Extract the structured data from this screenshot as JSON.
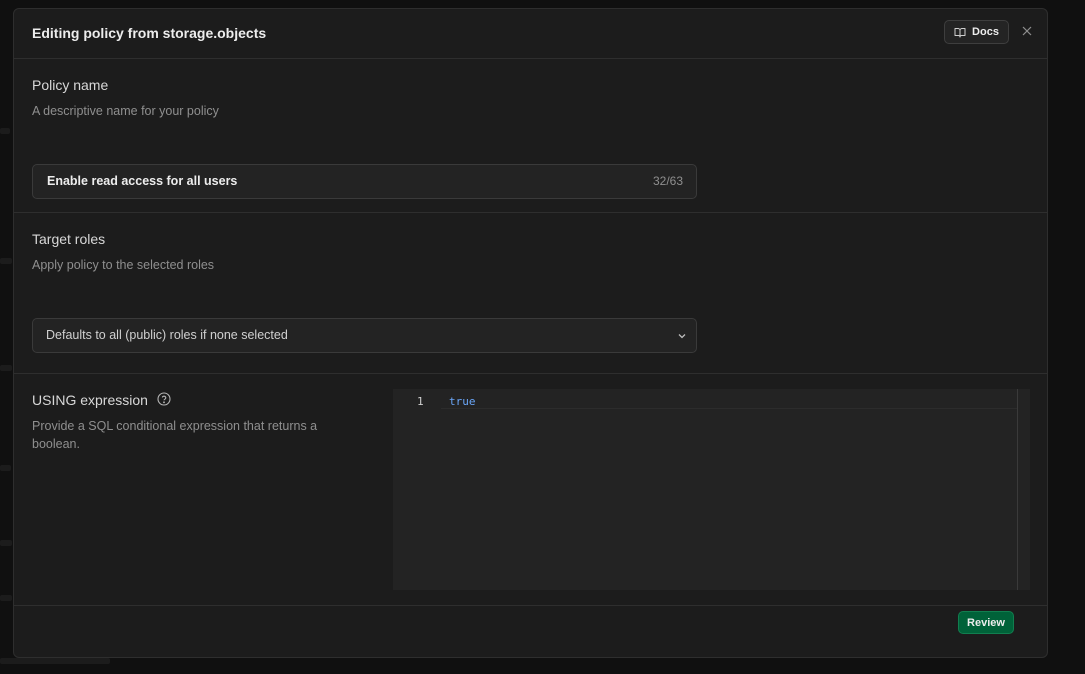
{
  "modal": {
    "title": "Editing policy from storage.objects",
    "docs_label": "Docs"
  },
  "policy_name": {
    "label": "Policy name",
    "description": "A descriptive name for your policy",
    "value": "Enable read access for all users",
    "counter": "32/63"
  },
  "target_roles": {
    "label": "Target roles",
    "description": "Apply policy to the selected roles",
    "selected_value": "Defaults to all (public) roles if none selected"
  },
  "using_expression": {
    "label": "USING expression",
    "description": "Provide a SQL conditional expression that returns a boolean.",
    "line_number": "1",
    "code": "true"
  },
  "footer": {
    "review_label": "Review"
  },
  "colors": {
    "accent": "#006239",
    "code_keyword": "#6aa6f8"
  },
  "icons": {
    "docs": "book-open-icon",
    "close": "close-icon",
    "help": "help-circle-icon",
    "dropdown": "chevron-down-icon"
  }
}
